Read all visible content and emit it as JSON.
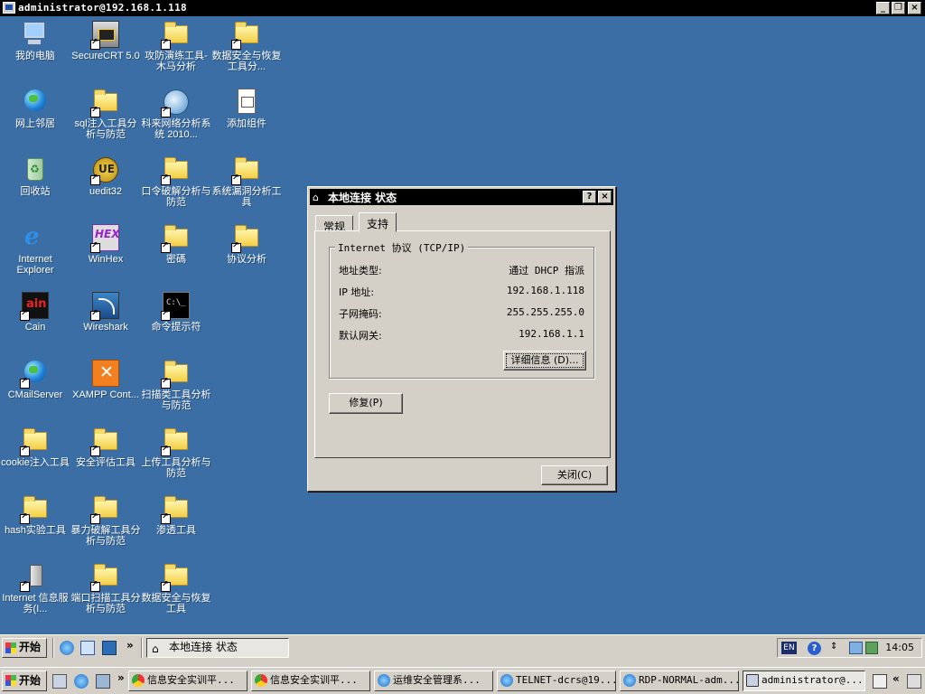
{
  "rdp_window": {
    "title": "administrator@192.168.1.118",
    "buttons": [
      "_",
      "❐",
      "×"
    ]
  },
  "desktop_icons": [
    {
      "label": "我的电脑",
      "icon": "computer-icon"
    },
    {
      "label": "SecureCRT 5.0",
      "icon": "securecrt-icon"
    },
    {
      "label": "攻防演练工具-木马分析",
      "icon": "folder-icon"
    },
    {
      "label": "数据安全与恢复工具分...",
      "icon": "folder-icon"
    },
    {
      "label": "网上邻居",
      "icon": "network-places-icon"
    },
    {
      "label": "sql注入工具分析与防范",
      "icon": "folder-icon"
    },
    {
      "label": "科来网络分析系统 2010...",
      "icon": "colasoft-icon"
    },
    {
      "label": "添加组件",
      "icon": "add-components-icon"
    },
    {
      "label": "回收站",
      "icon": "recycle-bin-icon"
    },
    {
      "label": "uedit32",
      "icon": "ultraedit-icon"
    },
    {
      "label": "口令破解分析与防范",
      "icon": "folder-icon"
    },
    {
      "label": "系统漏洞分析工具",
      "icon": "folder-icon"
    },
    {
      "label": "Internet Explorer",
      "icon": "internet-explorer-icon"
    },
    {
      "label": "WinHex",
      "icon": "winhex-icon"
    },
    {
      "label": "密碼",
      "icon": "folder-icon"
    },
    {
      "label": "协议分析",
      "icon": "folder-icon"
    },
    {
      "label": "Cain",
      "icon": "cain-icon"
    },
    {
      "label": "Wireshark",
      "icon": "wireshark-icon"
    },
    {
      "label": "命令提示符",
      "icon": "command-prompt-icon"
    },
    {
      "label": "CMailServer",
      "icon": "cmailserver-icon"
    },
    {
      "label": "XAMPP Cont...",
      "icon": "xampp-icon"
    },
    {
      "label": "扫描类工具分析与防范",
      "icon": "folder-icon"
    },
    {
      "label": "cookie注入工具",
      "icon": "folder-icon"
    },
    {
      "label": "安全评估工具",
      "icon": "folder-icon"
    },
    {
      "label": "上传工具分析与防范",
      "icon": "folder-icon"
    },
    {
      "label": "hash实验工具",
      "icon": "folder-icon"
    },
    {
      "label": "暴力破解工具分析与防范",
      "icon": "folder-icon"
    },
    {
      "label": "渗透工具",
      "icon": "folder-icon"
    },
    {
      "label": "Internet 信息服务(I...",
      "icon": "iis-icon"
    },
    {
      "label": "端口扫描工具分析与防范",
      "icon": "folder-icon"
    },
    {
      "label": "数据安全与恢复工具",
      "icon": "folder-icon"
    }
  ],
  "dialog": {
    "title": "本地连接 状态",
    "help_button": "?",
    "close_x": "×",
    "tabs": [
      "常规",
      "支持"
    ],
    "active_tab": "支持",
    "group_title": "Internet 协议 (TCP/IP)",
    "rows": [
      {
        "key": "地址类型:",
        "value": "通过 DHCP 指派"
      },
      {
        "key": "IP 地址:",
        "value": "192.168.1.118"
      },
      {
        "key": "子网掩码:",
        "value": "255.255.255.0"
      },
      {
        "key": "默认网关:",
        "value": "192.168.1.1"
      }
    ],
    "details_button": "详细信息 (D)...",
    "repair_button": "修复(P)",
    "close_button": "关闭(C)"
  },
  "inner_taskbar": {
    "start_label": "开始",
    "quick_launch": [
      "ie-icon",
      "outlook-icon",
      "wireshark-icon"
    ],
    "chevron": "»",
    "task": "本地连接 状态",
    "lang": "EN",
    "clock": "14:05"
  },
  "outer_taskbar": {
    "start_label": "开始",
    "chevron": "»",
    "tasks": [
      {
        "label": "信息安全实训平...",
        "icon": "chrome-icon"
      },
      {
        "label": "信息安全实训平...",
        "icon": "chrome-icon"
      },
      {
        "label": "运维安全管理系...",
        "icon": "ie-icon"
      },
      {
        "label": "TELNET-dcrs@19...",
        "icon": "ie-icon"
      },
      {
        "label": "RDP-NORMAL-adm...",
        "icon": "ie-icon"
      },
      {
        "label": "administrator@...",
        "icon": "rdp-icon"
      }
    ],
    "tray_chevron": "«"
  }
}
